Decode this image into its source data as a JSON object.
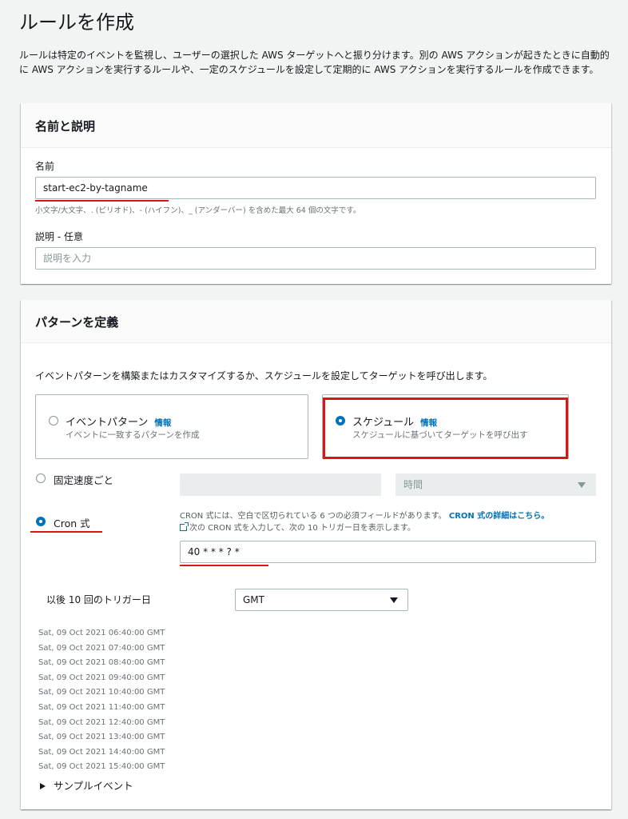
{
  "page": {
    "title": "ルールを作成",
    "description": "ルールは特定のイベントを監視し、ユーザーの選択した AWS ターゲットへと振り分けます。別の AWS アクションが起きたときに自動的に AWS アクションを実行するルールや、一定のスケジュールを設定して定期的に AWS アクションを実行するルールを作成できます。"
  },
  "name_section": {
    "title": "名前と説明",
    "name_label": "名前",
    "name_value": "start-ec2-by-tagname",
    "name_hint": "小文字/大文字、. (ピリオド)、- (ハイフン)、_ (アンダーバー) を含めた最大 64 個の文字です。",
    "desc_label": "説明 - 任意",
    "desc_placeholder": "説明を入力"
  },
  "pattern_section": {
    "title": "パターンを定義",
    "intro": "イベントパターンを構築またはカスタマイズするか、スケジュールを設定してターゲットを呼び出します。",
    "tiles": [
      {
        "title": "イベントパターン",
        "info": "情報",
        "sub": "イベントに一致するパターンを作成",
        "checked": false
      },
      {
        "title": "スケジュール",
        "info": "情報",
        "sub": "スケジュールに基づいてターゲットを呼び出す",
        "checked": true
      }
    ],
    "fixed_rate_label": "固定速度ごと",
    "fixed_rate_value": "",
    "fixed_rate_unit": "時間",
    "cron_label": "Cron 式",
    "cron_help_1": "CRON 式には、空白で区切られている 6 つの必須フィールドがあります。",
    "cron_help_link": "CRON 式の詳細はこちら。",
    "cron_help_2": "次の CRON 式を入力して、次の 10 トリガー日を表示します。",
    "cron_value": "40 * * * ? *",
    "next_triggers_label": "以後 10 回のトリガー日",
    "timezone": "GMT",
    "triggers": [
      "Sat, 09 Oct 2021 06:40:00 GMT",
      "Sat, 09 Oct 2021 07:40:00 GMT",
      "Sat, 09 Oct 2021 08:40:00 GMT",
      "Sat, 09 Oct 2021 09:40:00 GMT",
      "Sat, 09 Oct 2021 10:40:00 GMT",
      "Sat, 09 Oct 2021 11:40:00 GMT",
      "Sat, 09 Oct 2021 12:40:00 GMT",
      "Sat, 09 Oct 2021 13:40:00 GMT",
      "Sat, 09 Oct 2021 14:40:00 GMT",
      "Sat, 09 Oct 2021 15:40:00 GMT"
    ],
    "sample_event_label": "サンプルイベント"
  },
  "colors": {
    "accent": "#0073bb",
    "annotation_red": "#d91515"
  }
}
